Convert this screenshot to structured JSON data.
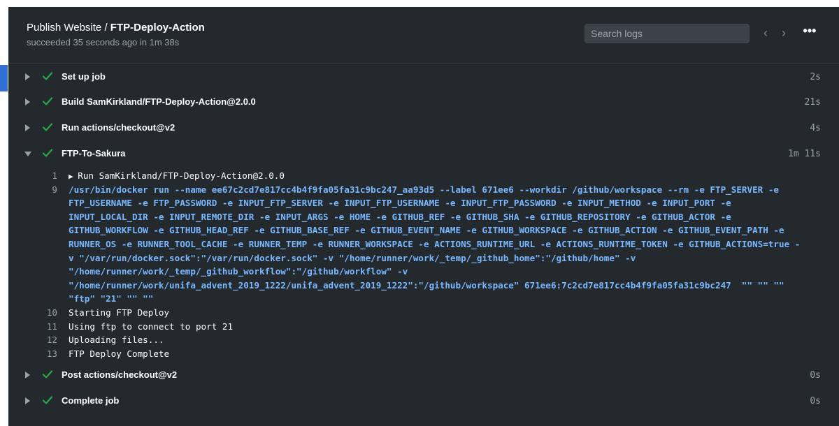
{
  "header": {
    "workflow": "Publish Website",
    "separator": " / ",
    "job": "FTP-Deploy-Action",
    "status": "succeeded 35 seconds ago in 1m 38s",
    "search_placeholder": "Search logs",
    "prev_icon": "‹",
    "next_icon": "›",
    "more_icon": "•••"
  },
  "colors": {
    "panel_bg": "#24292e",
    "success_green": "#28a745",
    "command_blue": "#79b8ff",
    "accent_blue": "#2f6fd6"
  },
  "steps": [
    {
      "label": "Set up job",
      "duration": "2s",
      "expanded": false
    },
    {
      "label": "Build SamKirkland/FTP-Deploy-Action@2.0.0",
      "duration": "21s",
      "expanded": false
    },
    {
      "label": "Run actions/checkout@v2",
      "duration": "4s",
      "expanded": false
    },
    {
      "label": "FTP-To-Sakura",
      "duration": "1m 11s",
      "expanded": true
    },
    {
      "label": "Post actions/checkout@v2",
      "duration": "0s",
      "expanded": false
    },
    {
      "label": "Complete job",
      "duration": "0s",
      "expanded": false
    }
  ],
  "log": [
    {
      "num": "1",
      "text": "Run SamKirkland/FTP-Deploy-Action@2.0.0",
      "group": true
    },
    {
      "num": "9",
      "text": "/usr/bin/docker run --name ee67c2cd7e817cc4b4f9fa05fa31c9bc247_aa93d5 --label 671ee6 --workdir /github/workspace --rm -e FTP_SERVER -e",
      "cmd": true
    },
    {
      "num": "",
      "text": "FTP_USERNAME -e FTP_PASSWORD -e INPUT_FTP_SERVER -e INPUT_FTP_USERNAME -e INPUT_FTP_PASSWORD -e INPUT_METHOD -e INPUT_PORT -e",
      "cmd": true
    },
    {
      "num": "",
      "text": "INPUT_LOCAL_DIR -e INPUT_REMOTE_DIR -e INPUT_ARGS -e HOME -e GITHUB_REF -e GITHUB_SHA -e GITHUB_REPOSITORY -e GITHUB_ACTOR -e",
      "cmd": true
    },
    {
      "num": "",
      "text": "GITHUB_WORKFLOW -e GITHUB_HEAD_REF -e GITHUB_BASE_REF -e GITHUB_EVENT_NAME -e GITHUB_WORKSPACE -e GITHUB_ACTION -e GITHUB_EVENT_PATH -e",
      "cmd": true
    },
    {
      "num": "",
      "text": "RUNNER_OS -e RUNNER_TOOL_CACHE -e RUNNER_TEMP -e RUNNER_WORKSPACE -e ACTIONS_RUNTIME_URL -e ACTIONS_RUNTIME_TOKEN -e GITHUB_ACTIONS=true -",
      "cmd": true
    },
    {
      "num": "",
      "text": "v \"/var/run/docker.sock\":\"/var/run/docker.sock\" -v \"/home/runner/work/_temp/_github_home\":\"/github/home\" -v",
      "cmd": true
    },
    {
      "num": "",
      "text": "\"/home/runner/work/_temp/_github_workflow\":\"/github/workflow\" -v",
      "cmd": true
    },
    {
      "num": "",
      "text": "\"/home/runner/work/unifa_advent_2019_1222/unifa_advent_2019_1222\":\"/github/workspace\" 671ee6:7c2cd7e817cc4b4f9fa05fa31c9bc247  \"\" \"\" \"\"",
      "cmd": true
    },
    {
      "num": "",
      "text": "\"ftp\" \"21\" \"\" \"\"",
      "cmd": true
    },
    {
      "num": "10",
      "text": "Starting FTP Deploy"
    },
    {
      "num": "11",
      "text": "Using ftp to connect to port 21"
    },
    {
      "num": "12",
      "text": "Uploading files..."
    },
    {
      "num": "13",
      "text": "FTP Deploy Complete"
    }
  ]
}
